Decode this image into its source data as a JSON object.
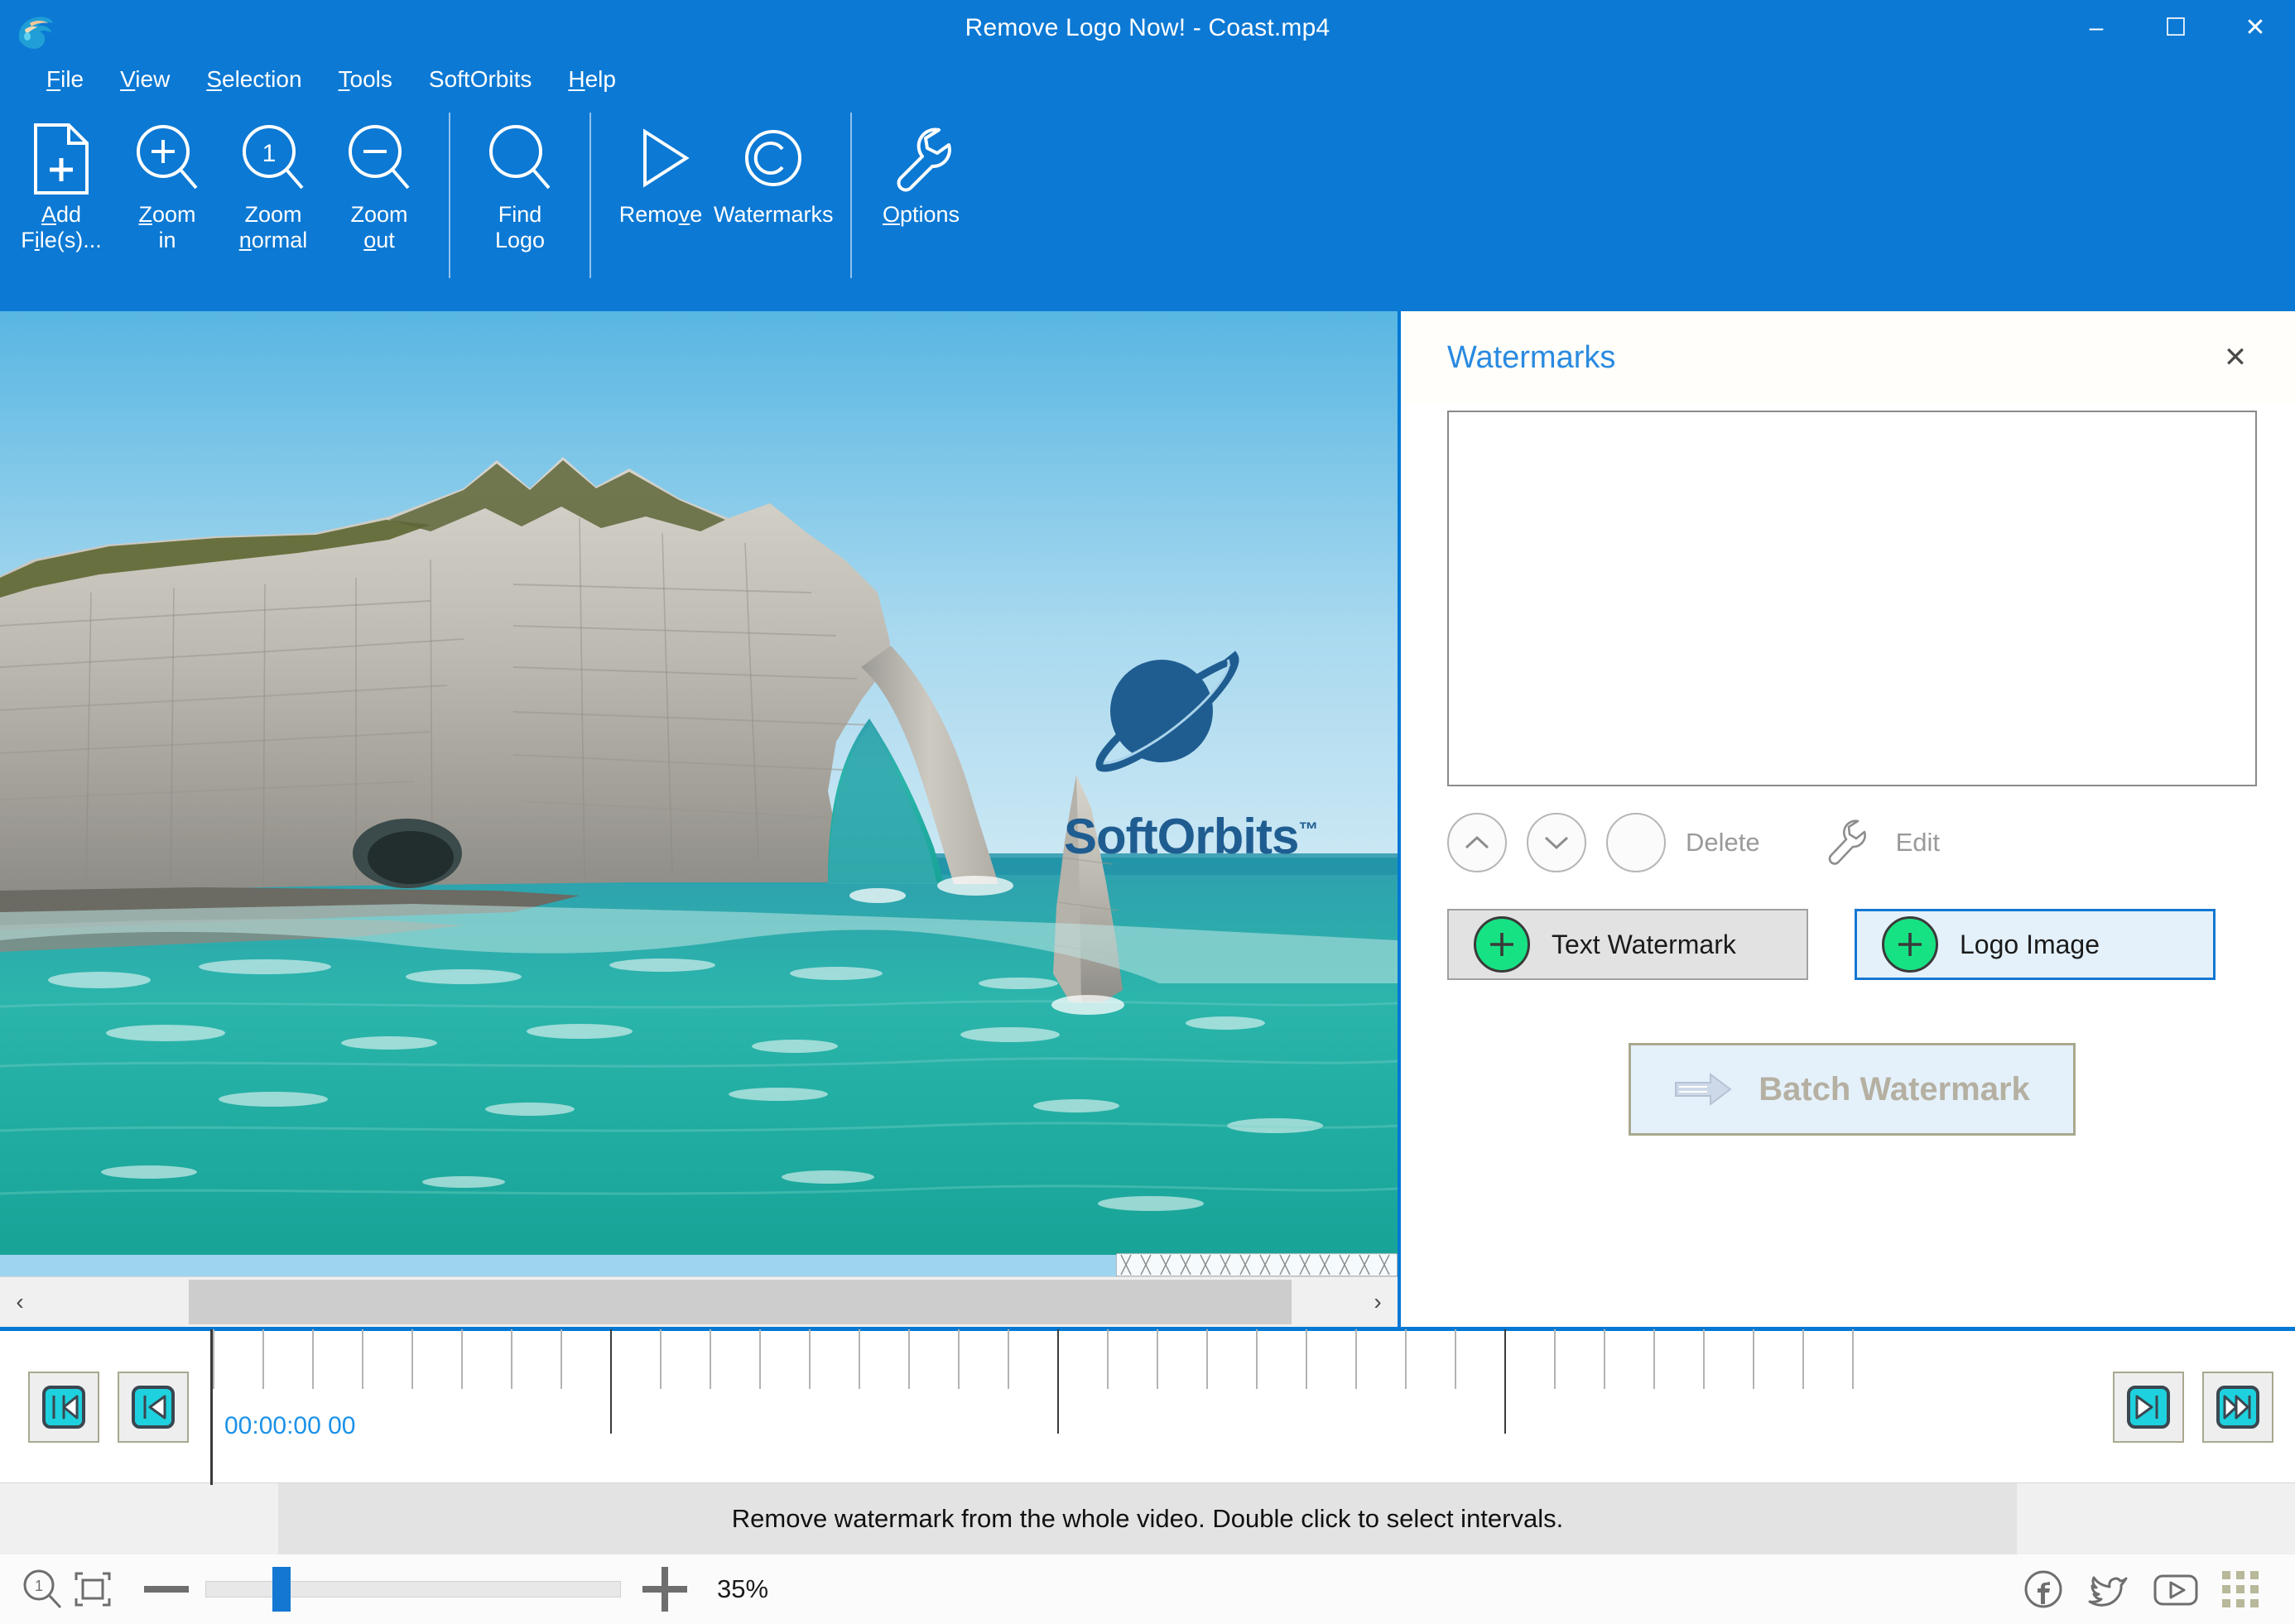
{
  "window": {
    "title": "Remove Logo Now! - Coast.mp4",
    "app_icon": "dolphin-app-icon",
    "controls": {
      "minimize": "–",
      "maximize": "☐",
      "close": "✕"
    }
  },
  "menubar": {
    "items": [
      {
        "label": "File",
        "accel": "F"
      },
      {
        "label": "View",
        "accel": "V"
      },
      {
        "label": "Selection",
        "accel": "S"
      },
      {
        "label": "Tools",
        "accel": "T"
      },
      {
        "label": "SoftOrbits",
        "accel": ""
      },
      {
        "label": "Help",
        "accel": "H"
      }
    ]
  },
  "toolbar": {
    "buttons": [
      {
        "label": "Add\nFile(s)...",
        "icon": "add-file-icon"
      },
      {
        "label": "Zoom\nin",
        "icon": "zoom-in-icon"
      },
      {
        "label": "Zoom\nnormal",
        "icon": "zoom-normal-icon"
      },
      {
        "label": "Zoom\nout",
        "icon": "zoom-out-icon"
      },
      {
        "label": "Find\nLogo",
        "icon": "find-logo-icon"
      },
      {
        "label": "Remove",
        "icon": "play-triangle-icon"
      },
      {
        "label": "Watermarks",
        "icon": "copyright-icon"
      },
      {
        "label": "Options",
        "icon": "wrench-icon"
      }
    ]
  },
  "canvas": {
    "file_name": "Coast.mp4",
    "watermark_logo_text": "SoftOrbits",
    "watermark_logo_tm": "™",
    "watermark_logo_icon": "saturn-planet-icon",
    "scrollbar": {
      "left_arrow": "‹",
      "right_arrow": "›"
    }
  },
  "panel": {
    "title": "Watermarks",
    "close_label": "✕",
    "list_items": [],
    "actions": [
      {
        "name": "move-up",
        "icon": "chevron-up-icon",
        "label": ""
      },
      {
        "name": "move-down",
        "icon": "chevron-down-icon",
        "label": ""
      },
      {
        "name": "delete",
        "icon": "delete-icon",
        "label": "Delete"
      },
      {
        "name": "edit",
        "icon": "wrench-icon",
        "label": "Edit"
      }
    ],
    "add_buttons": [
      {
        "label": "Text Watermark",
        "icon": "plus-circle-icon",
        "state": "normal"
      },
      {
        "label": "Logo Image",
        "icon": "plus-circle-icon",
        "state": "focused"
      }
    ],
    "batch_button": {
      "label": "Batch Watermark",
      "icon": "arrow-right-icon",
      "disabled": true
    }
  },
  "timeline": {
    "left_buttons": [
      {
        "name": "go-to-start",
        "icon": "skip-backward-icon"
      },
      {
        "name": "prev-frame",
        "icon": "step-backward-icon"
      }
    ],
    "right_buttons": [
      {
        "name": "next-frame",
        "icon": "step-forward-icon"
      },
      {
        "name": "go-to-end",
        "icon": "skip-forward-icon"
      }
    ],
    "current_time": "00:00:00 00"
  },
  "statusbar": {
    "message": "Remove watermark from the whole video. Double click to select intervals."
  },
  "zoombar": {
    "zoom_normal_icon": "zoom-one-to-one-icon",
    "fit_icon": "fit-to-screen-icon",
    "minus_label": "−",
    "plus_label": "+",
    "zoom_value": "35%",
    "social": [
      {
        "name": "facebook-icon",
        "label": "f"
      },
      {
        "name": "twitter-icon",
        "label": ""
      },
      {
        "name": "youtube-icon",
        "label": ""
      }
    ]
  },
  "colors": {
    "titlebar_blue": "#0c79d4",
    "accent_blue": "#0078d4",
    "panel_title_blue": "#2a8ae0",
    "plus_green": "#17e283",
    "timeline_cyan": "#1ed1de",
    "time_text_blue": "#1c92e8",
    "disabled_gray": "#9a9a9a"
  }
}
